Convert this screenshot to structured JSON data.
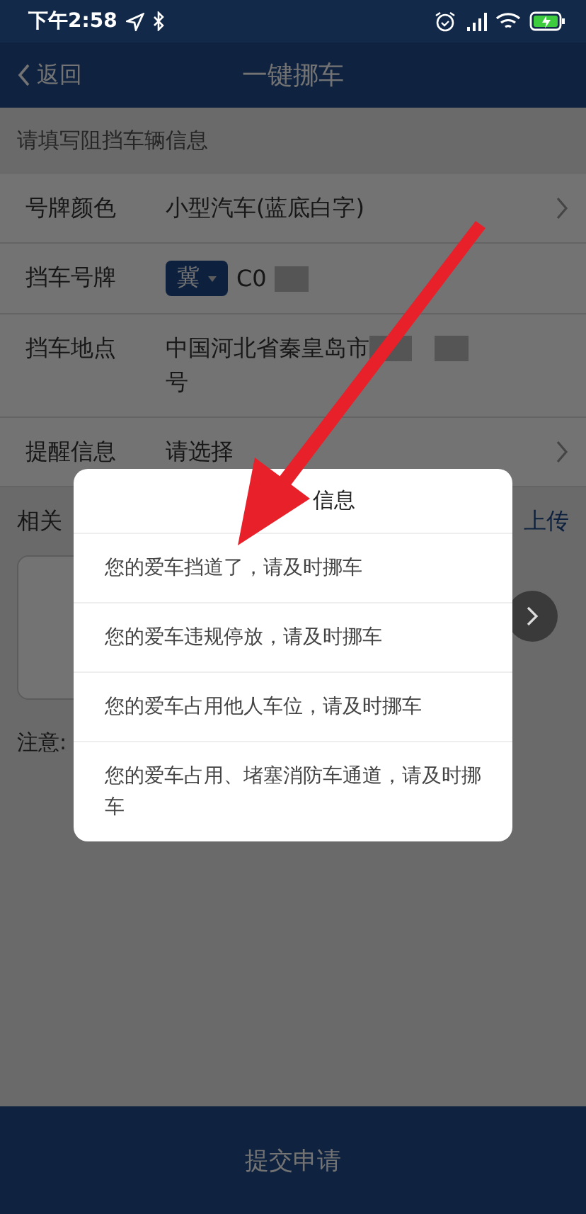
{
  "status_bar": {
    "time": "下午2:58"
  },
  "header": {
    "back": "返回",
    "title": "一键挪车"
  },
  "section_hint": "请填写阻挡车辆信息",
  "form": [
    {
      "kind": "select",
      "label": "号牌颜色",
      "value": "小型汽车(蓝底白字)"
    },
    {
      "kind": "plate",
      "label": "挡车号牌",
      "province": "冀",
      "value": "C0"
    },
    {
      "kind": "address",
      "label": "挡车地点",
      "value": "中国河北省秦皇岛市",
      "value_2": "号"
    },
    {
      "kind": "select",
      "label": "提醒信息",
      "value": "请选择"
    }
  ],
  "photos": {
    "label": "相关",
    "action": "上传"
  },
  "note": "注意:",
  "dialog": {
    "title": "信息",
    "options": [
      "您的爱车挡道了，请及时挪车",
      "您的爱车违规停放，请及时挪车",
      "您的爱车占用他人车位，请及时挪车",
      "您的爱车占用、堵塞消防车通道，请及时挪车"
    ]
  },
  "submit": "提交申请"
}
